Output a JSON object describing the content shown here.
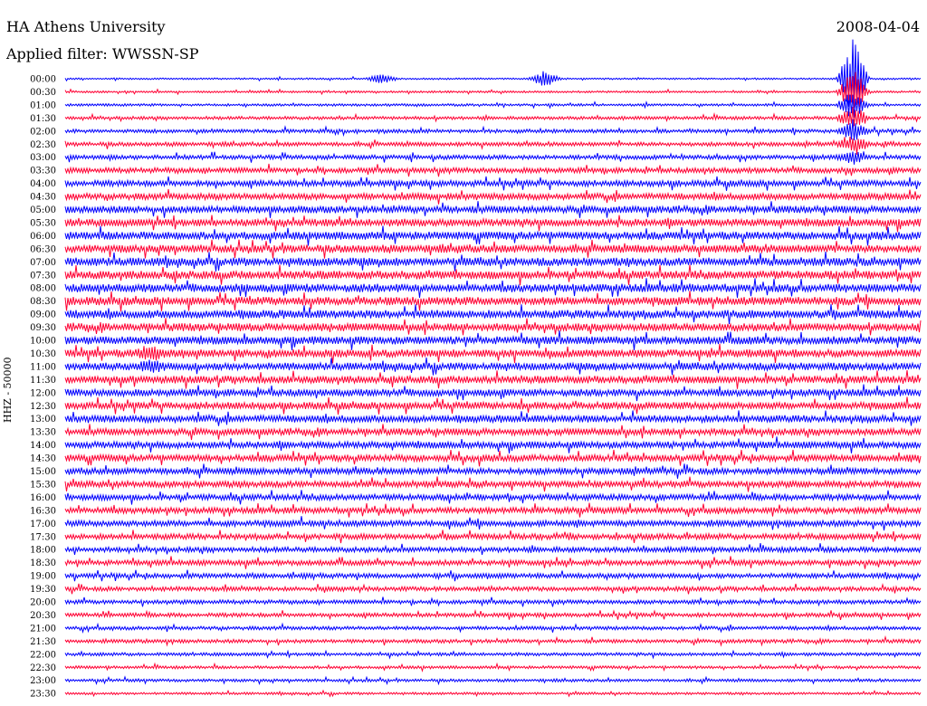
{
  "header": {
    "title": "HA Athens University",
    "filter": "Applied filter: WWSSN-SP",
    "date": "2008-04-04"
  },
  "chart_data": {
    "type": "line",
    "title": "HA Athens University",
    "subtitle": "Applied filter: WWSSN-SP",
    "date": "2008-04-04",
    "ylabel": "HHZ - 50000",
    "xlabel": "",
    "row_labels": [
      "00:00",
      "00:30",
      "01:00",
      "01:30",
      "02:00",
      "02:30",
      "03:00",
      "03:30",
      "04:00",
      "04:30",
      "05:00",
      "05:30",
      "06:00",
      "06:30",
      "07:00",
      "07:30",
      "08:00",
      "08:30",
      "09:00",
      "09:30",
      "10:00",
      "10:30",
      "11:00",
      "11:30",
      "12:00",
      "12:30",
      "13:00",
      "13:30",
      "14:00",
      "14:30",
      "15:00",
      "15:30",
      "16:00",
      "16:30",
      "17:00",
      "17:30",
      "18:00",
      "18:30",
      "19:00",
      "19:30",
      "20:00",
      "20:30",
      "21:00",
      "21:30",
      "22:00",
      "22:30",
      "23:00",
      "23:30"
    ],
    "row_duration_minutes": 15,
    "colors": [
      "#0000ff",
      "#ff0033"
    ],
    "noise_amplitude": [
      0.4,
      0.5,
      0.6,
      0.8,
      0.9,
      1.0,
      1.1,
      1.3,
      1.5,
      1.6,
      1.8,
      1.9,
      2.0,
      2.0,
      2.1,
      2.1,
      2.1,
      2.1,
      2.1,
      2.0,
      2.0,
      2.0,
      1.9,
      1.9,
      1.8,
      1.8,
      1.8,
      1.7,
      1.7,
      1.7,
      1.6,
      1.6,
      1.5,
      1.5,
      1.5,
      1.4,
      1.3,
      1.3,
      1.2,
      1.1,
      1.0,
      1.0,
      0.9,
      0.9,
      0.8,
      0.7,
      0.7,
      0.6
    ],
    "events": [
      {
        "row": 0,
        "position": 0.37,
        "amplitude": 2.5
      },
      {
        "row": 0,
        "position": 0.56,
        "amplitude": 4.0
      },
      {
        "row": 0,
        "position": 0.92,
        "amplitude": 20.0
      },
      {
        "row": 1,
        "position": 0.92,
        "amplitude": 12.0
      },
      {
        "row": 2,
        "position": 0.92,
        "amplitude": 8.0
      },
      {
        "row": 3,
        "position": 0.92,
        "amplitude": 6.0
      },
      {
        "row": 4,
        "position": 0.92,
        "amplitude": 5.0
      },
      {
        "row": 5,
        "position": 0.92,
        "amplitude": 4.0
      },
      {
        "row": 6,
        "position": 0.92,
        "amplitude": 3.0
      },
      {
        "row": 21,
        "position": 0.1,
        "amplitude": 3.0
      },
      {
        "row": 22,
        "position": 0.1,
        "amplitude": 2.5
      }
    ]
  }
}
